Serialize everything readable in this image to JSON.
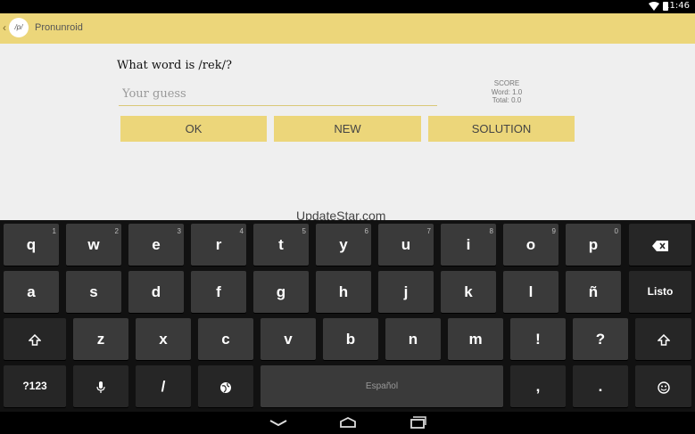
{
  "status_bar": {
    "time": "11:46"
  },
  "action_bar": {
    "logo_text": "/p/",
    "title": "Pronunroid",
    "back_glyph": "‹"
  },
  "quiz": {
    "question": "What word is /rek/?",
    "guess_placeholder": "Your guess",
    "score": {
      "heading": "SCORE",
      "word": "Word: 1.0",
      "total": "Total: 0.0"
    },
    "buttons": {
      "ok": "OK",
      "new": "NEW",
      "solution": "SOLUTION"
    }
  },
  "watermark": "UpdateStar.com",
  "keyboard": {
    "row1": [
      {
        "label": "q",
        "hint": "1"
      },
      {
        "label": "w",
        "hint": "2"
      },
      {
        "label": "e",
        "hint": "3"
      },
      {
        "label": "r",
        "hint": "4"
      },
      {
        "label": "t",
        "hint": "5"
      },
      {
        "label": "y",
        "hint": "6"
      },
      {
        "label": "u",
        "hint": "7"
      },
      {
        "label": "i",
        "hint": "8"
      },
      {
        "label": "o",
        "hint": "9"
      },
      {
        "label": "p",
        "hint": "0"
      }
    ],
    "row2": [
      "a",
      "s",
      "d",
      "f",
      "g",
      "h",
      "j",
      "k",
      "l",
      "ñ"
    ],
    "row3": [
      "z",
      "x",
      "c",
      "v",
      "b",
      "n",
      "m",
      "!",
      "?"
    ],
    "done_label": "Listo",
    "symbols_label": "?123",
    "slash_label": "/",
    "space_label": "Español",
    "comma_label": ",",
    "period_label": ".",
    "icons": [
      "backspace-icon",
      "shift-icon",
      "microphone-icon",
      "globe-icon",
      "emoji-icon"
    ]
  },
  "nav_icons": [
    "back-icon",
    "home-icon",
    "recents-icon"
  ]
}
